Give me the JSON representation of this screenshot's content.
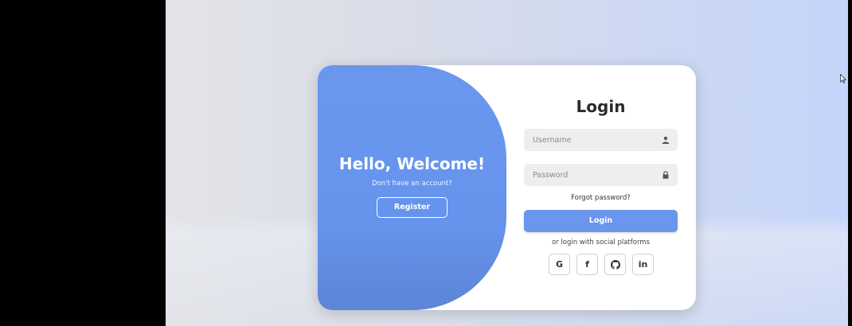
{
  "welcome": {
    "title": "Hello, Welcome!",
    "subtitle": "Don't have an account?",
    "register_label": "Register"
  },
  "login": {
    "title": "Login",
    "username_placeholder": "Username",
    "password_placeholder": "Password",
    "forgot_label": "Forgot password?",
    "login_label": "Login",
    "social_text": "or login with social platforms",
    "social": [
      {
        "icon": "google-icon",
        "glyph": "G"
      },
      {
        "icon": "facebook-icon",
        "glyph": "f"
      },
      {
        "icon": "github-icon",
        "glyph": ""
      },
      {
        "icon": "linkedin-icon",
        "glyph": "in"
      }
    ]
  },
  "colors": {
    "accent": "#6b96ee",
    "panel": "#6693ec",
    "field_bg": "#eeeeee"
  }
}
